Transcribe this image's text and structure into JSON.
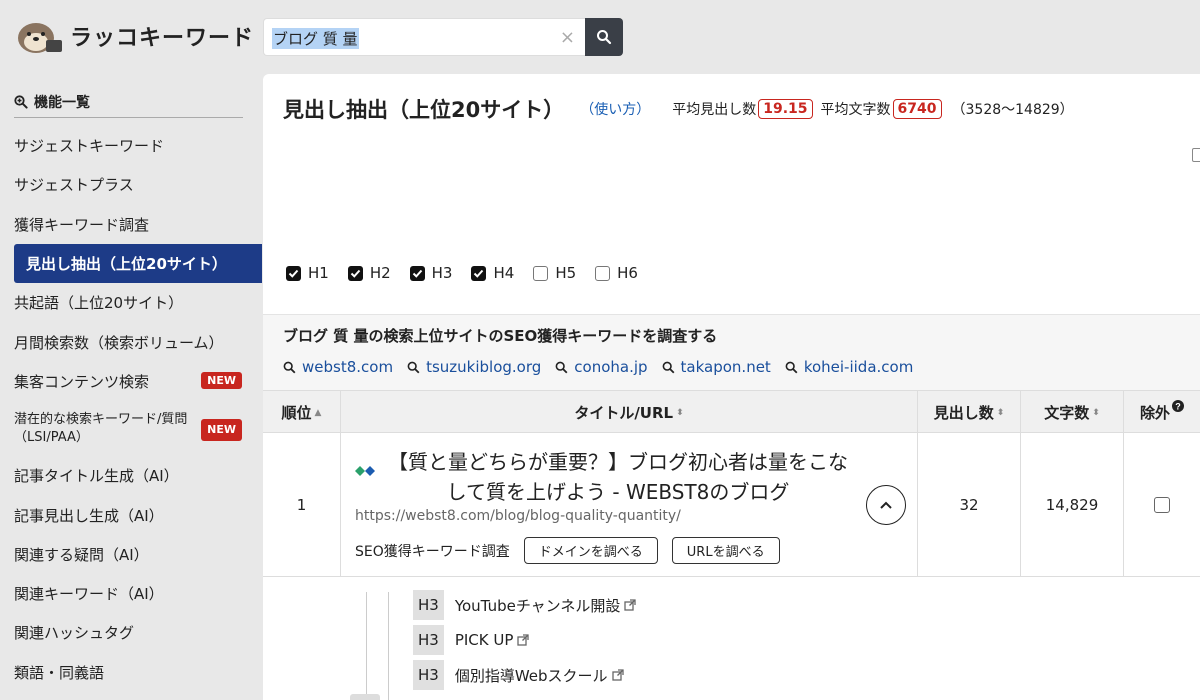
{
  "app": {
    "logo_text": "ラッコキーワード"
  },
  "search": {
    "value": "ブログ 質 量",
    "clear_glyph": "×"
  },
  "sidebar": {
    "header": "機能一覧",
    "items": [
      {
        "label": "サジェストキーワード"
      },
      {
        "label": "サジェストプラス"
      },
      {
        "label": "獲得キーワード調査"
      },
      {
        "label": "見出し抽出（上位20サイト）",
        "active": true
      },
      {
        "label": "共起語（上位20サイト）"
      },
      {
        "label": "月間検索数（検索ボリューム）"
      },
      {
        "label": "集客コンテンツ検索",
        "badge": "NEW"
      },
      {
        "label": "潜在的な検索キーワード/質問（LSI/PAA）",
        "badge": "NEW"
      },
      {
        "label": "記事タイトル生成（AI）"
      },
      {
        "label": "記事見出し生成（AI）"
      },
      {
        "label": "関連する疑問（AI）"
      },
      {
        "label": "関連キーワード（AI）"
      },
      {
        "label": "関連ハッシュタグ"
      },
      {
        "label": "類語・同義語"
      }
    ]
  },
  "main": {
    "title": "見出し抽出（上位20サイト）",
    "help_link": "（使い方）",
    "avg_headings_label": "平均見出し数",
    "avg_headings_value": "19.15",
    "avg_chars_label": "平均文字数",
    "avg_chars_value": "6740",
    "range": "（3528〜14829）",
    "heading_filters": [
      {
        "label": "H1",
        "checked": true
      },
      {
        "label": "H2",
        "checked": true
      },
      {
        "label": "H3",
        "checked": true
      },
      {
        "label": "H4",
        "checked": true
      },
      {
        "label": "H5",
        "checked": false
      },
      {
        "label": "H6",
        "checked": false
      }
    ],
    "seo_section": {
      "title": "ブログ 質 量の検索上位サイトのSEO獲得キーワードを調査する",
      "domains": [
        "webst8.com",
        "tsuzukiblog.org",
        "conoha.jp",
        "takapon.net",
        "kohei-iida.com"
      ]
    },
    "table": {
      "headers": {
        "rank": "順位",
        "title_url": "タイトル/URL",
        "headings": "見出し数",
        "chars": "文字数",
        "exclude": "除外"
      },
      "rows": [
        {
          "rank": "1",
          "title": "【質と量どちらが重要？】ブログ初心者は量をこなして質を上げよう - WEBST8のブログ",
          "url": "https://webst8.com/blog/blog-quality-quantity/",
          "seo_label": "SEO獲得キーワード調査",
          "domain_btn": "ドメインを調べる",
          "url_btn": "URLを調べる",
          "headings": "32",
          "chars": "14,829"
        }
      ]
    },
    "heading_list": [
      {
        "tag": "H3",
        "text": "YouTubeチャンネル開設"
      },
      {
        "tag": "H3",
        "text": "PICK UP"
      },
      {
        "tag": "H3",
        "text": "個別指導Webスクール"
      }
    ]
  }
}
